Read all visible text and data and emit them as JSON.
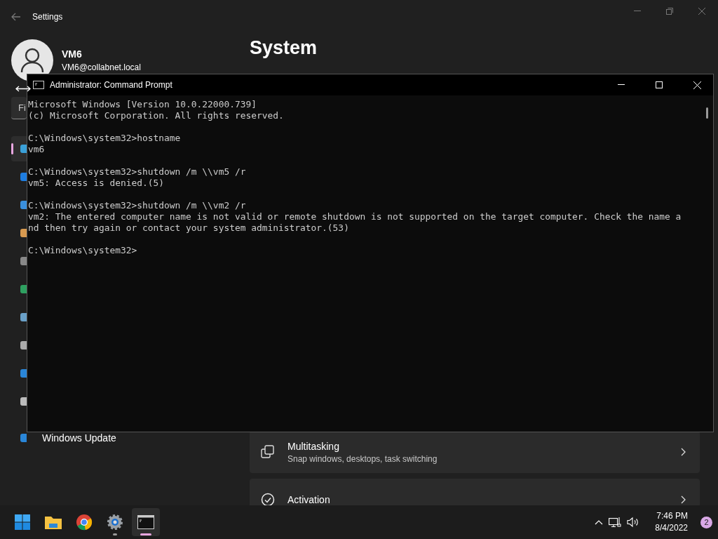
{
  "settings_window": {
    "title": "Settings",
    "profile": {
      "name": "VM6",
      "email": "VM6@collabnet.local"
    },
    "search": {
      "placeholder": "Fi"
    },
    "heading": "System",
    "sidebar": {
      "items": [
        {
          "selected": true
        },
        {
          "selected": false
        },
        {
          "selected": false
        },
        {
          "selected": false
        },
        {
          "selected": false
        },
        {
          "selected": false
        },
        {
          "selected": false
        },
        {
          "selected": false
        },
        {
          "selected": false
        },
        {
          "selected": false
        },
        {
          "selected": false,
          "label": "Windows Update"
        }
      ]
    },
    "cards": [
      {
        "kind": "multitasking",
        "title": "Multitasking",
        "subtitle": "Snap windows, desktops, task switching"
      },
      {
        "kind": "activation",
        "title": "Activation"
      }
    ]
  },
  "cmd_window": {
    "title": "Administrator: Command Prompt",
    "blocks": [
      [
        "Microsoft Windows [Version 10.0.22000.739]",
        "(c) Microsoft Corporation. All rights reserved."
      ],
      [
        "C:\\Windows\\system32>hostname",
        "vm6"
      ],
      [
        "C:\\Windows\\system32>shutdown /m \\\\vm5 /r",
        "vm5: Access is denied.(5)"
      ],
      [
        "C:\\Windows\\system32>shutdown /m \\\\vm2 /r",
        "vm2: The entered computer name is not valid or remote shutdown is not supported on the target computer. Check the name a",
        "nd then try again or contact your system administrator.(53)"
      ],
      [
        "C:\\Windows\\system32>"
      ]
    ]
  },
  "taskbar": {
    "apps": [
      {
        "kind": "start",
        "running": false,
        "selected": false
      },
      {
        "kind": "explorer",
        "running": false,
        "selected": false
      },
      {
        "kind": "browser",
        "running": false,
        "selected": false
      },
      {
        "kind": "settings",
        "running": true,
        "selected": false
      },
      {
        "kind": "terminal",
        "running": true,
        "selected": true
      }
    ],
    "clock": {
      "time": "7:46 PM",
      "date": "8/4/2022"
    },
    "notifications": "2"
  }
}
